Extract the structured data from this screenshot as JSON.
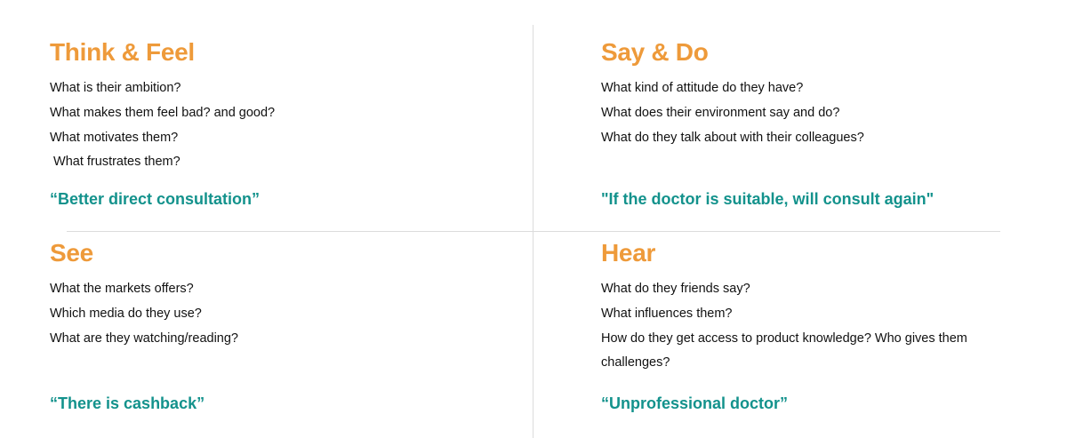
{
  "colors": {
    "title": "#EE9A3A",
    "quote": "#13928C",
    "text": "#111111",
    "divider": "#DCDCDC"
  },
  "quadrants": {
    "think_feel": {
      "title": "Think & Feel",
      "questions": [
        "What is their ambition?",
        "What makes them feel bad? and good?",
        "What motivates them?",
        " What frustrates them?"
      ],
      "quote": "“Better direct consultation”"
    },
    "say_do": {
      "title": "Say & Do",
      "questions": [
        "What kind of attitude do they have?",
        "What does their environment say and do?",
        "What do they talk about with their colleagues?"
      ],
      "quote": "\"If the doctor is suitable, will consult again\""
    },
    "see": {
      "title": "See",
      "questions": [
        "What the markets offers?",
        "Which media do they use?",
        "What are they watching/reading?"
      ],
      "quote": "“There is cashback”"
    },
    "hear": {
      "title": "Hear",
      "questions": [
        "What do they friends say?",
        "What influences them?",
        "How do they get access to product knowledge? Who gives them challenges?"
      ],
      "quote": "“Unprofessional doctor”"
    }
  }
}
